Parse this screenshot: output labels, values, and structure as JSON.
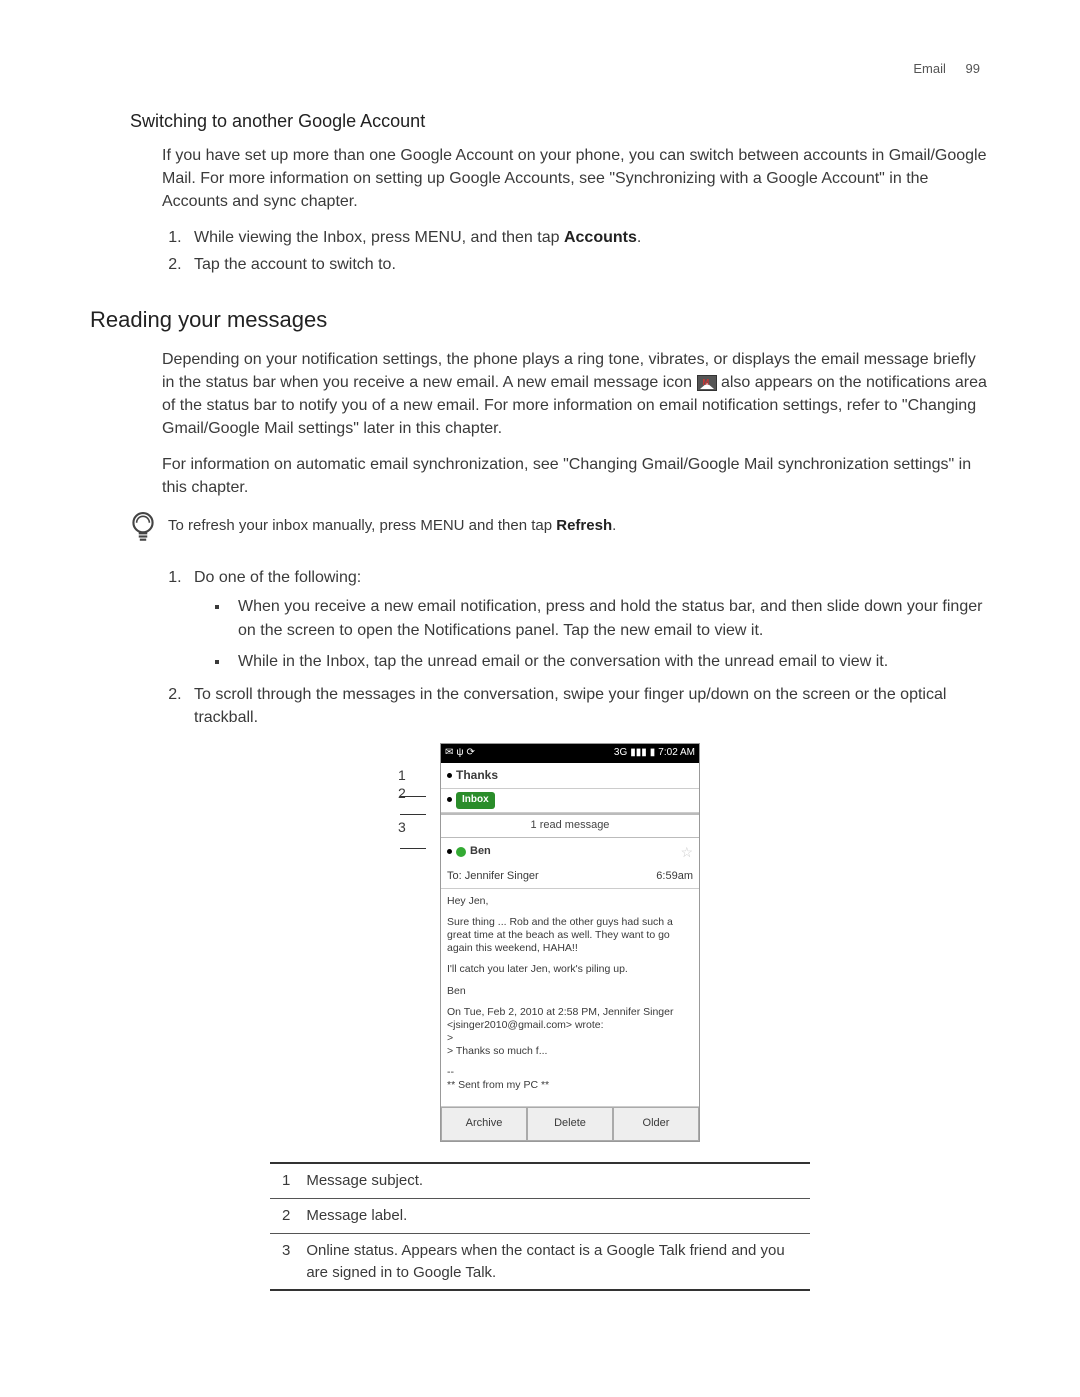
{
  "header": {
    "chapter": "Email",
    "page": "99"
  },
  "section1": {
    "title": "Switching to another Google Account",
    "intro": "If you have set up more than one Google Account on your phone, you can switch between accounts in Gmail/Google Mail. For more information on setting up Google Accounts, see \"Synchronizing with a Google Account\" in the Accounts and sync chapter.",
    "step1_pre": "While viewing the Inbox, press MENU, and then tap ",
    "step1_bold": "Accounts",
    "step1_post": ".",
    "step2": "Tap the account to switch to."
  },
  "section2": {
    "title": "Reading your messages",
    "para1_pre": "Depending on your notification settings, the phone plays a ring tone, vibrates, or displays the email message briefly in the status bar when you receive a new email. A new email message icon ",
    "para1_post": " also appears on the notifications area of the status bar to notify you of a new email. For more information on email notification settings, refer to \"Changing Gmail/Google Mail settings\" later in this chapter.",
    "para2": "For information on automatic email synchronization, see \"Changing Gmail/Google Mail synchronization settings\" in this chapter.",
    "tip_pre": "To refresh your inbox manually, press MENU and then tap ",
    "tip_bold": "Refresh",
    "tip_post": ".",
    "step1": "Do one of the following:",
    "bullet1": "When you receive a new email notification, press and hold the status bar, and then slide down your finger on the screen to open the Notifications panel. Tap the new email to view it.",
    "bullet2": "While in the Inbox, tap the unread email or the conversation with the unread email to view it.",
    "step2": "To scroll through the messages in the conversation, swipe your finger up/down on the screen or the optical trackball."
  },
  "phone": {
    "time": "7:02 AM",
    "net": "3G",
    "subject": "Thanks",
    "label": "Inbox",
    "read_row": "1 read message",
    "from": "Ben",
    "to": "To: Jennifer Singer",
    "msgtime": "6:59am",
    "body1": "Hey Jen,",
    "body2": "Sure thing ... Rob and the other guys had such a great time at the beach as well. They want to go again this weekend, HAHA!!",
    "body3": "I'll catch you later Jen, work's piling up.",
    "body4": "Ben",
    "quote1": "On Tue, Feb 2, 2010 at 2:58 PM, Jennifer Singer <jsinger2010@gmail.com> wrote:",
    "quote2": ">",
    "quote3": "> Thanks so much f...",
    "sig1": "--",
    "sig2": "** Sent from my PC **",
    "btn_archive": "Archive",
    "btn_delete": "Delete",
    "btn_older": "Older"
  },
  "callouts": {
    "c1": "1",
    "c2": "2",
    "c3": "3"
  },
  "legend": {
    "r1n": "1",
    "r1": "Message subject.",
    "r2n": "2",
    "r2": "Message label.",
    "r3n": "3",
    "r3": "Online status. Appears when the contact is a Google Talk friend and you are signed in to Google Talk."
  }
}
